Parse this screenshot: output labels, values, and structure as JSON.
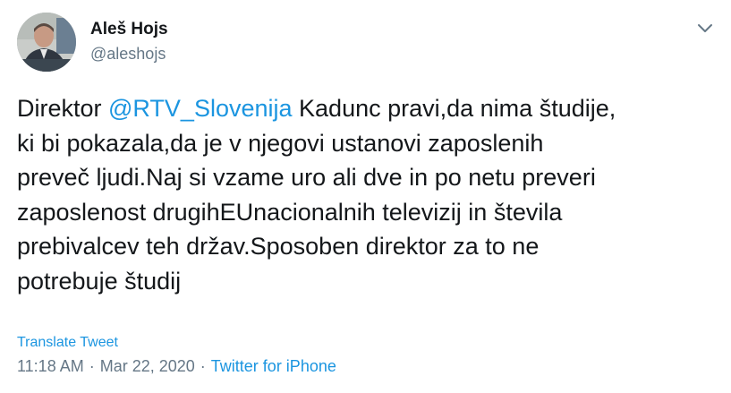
{
  "author": {
    "name": "Aleš Hojs",
    "handle": "@aleshojs"
  },
  "tweet": {
    "prefix": "Direktor ",
    "mention": "@RTV_Slovenija",
    "text_after_mention": " Kadunc pravi,da nima študije,\nki bi pokazala,da je v njegovi ustanovi zaposlenih\npreveč ljudi.Naj si vzame uro ali dve in po netu preveri\nzaposlenost drugihEUnacionalnih televizij in števila\nprebivalcev teh držav.Sposoben direktor za to ne\npotrebuje študij"
  },
  "translate_label": "Translate Tweet",
  "meta": {
    "time": "11:18 AM",
    "separator1": "·",
    "date": "Mar 22, 2020",
    "separator2": "·",
    "source": "Twitter for iPhone"
  },
  "icons": {
    "menu": "chevron-down-icon",
    "avatar": "profile-photo"
  },
  "colors": {
    "link": "#1b95e0",
    "secondary_text": "#657786",
    "primary_text": "#14171a"
  }
}
